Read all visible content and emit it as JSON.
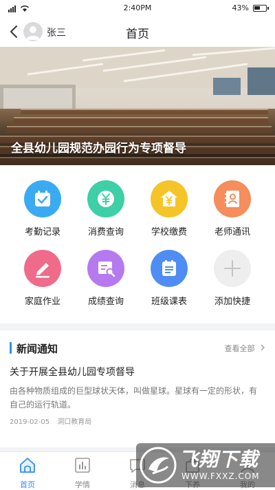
{
  "status_bar": {
    "time": "2:40PM",
    "battery": "43%"
  },
  "nav": {
    "user_name": "张三",
    "title": "首页"
  },
  "banner": {
    "caption": "全县幼儿园规范办园行为专项督导"
  },
  "shortcuts": [
    {
      "label": "考勤记录",
      "icon": "calendar-check-icon",
      "color": "#3aaaf2"
    },
    {
      "label": "消费查询",
      "icon": "yuan-coin-icon",
      "color": "#3dcfa6"
    },
    {
      "label": "学校缴费",
      "icon": "school-fee-icon",
      "color": "#f5c428"
    },
    {
      "label": "老师通讯",
      "icon": "contact-book-icon",
      "color": "#f58d5c"
    },
    {
      "label": "家庭作业",
      "icon": "pencil-icon",
      "color": "#f06b8a"
    },
    {
      "label": "成绩查询",
      "icon": "report-search-icon",
      "color": "#b57af0"
    },
    {
      "label": "班级课表",
      "icon": "schedule-list-icon",
      "color": "#4f8df5"
    },
    {
      "label": "添加快捷",
      "icon": "plus-icon",
      "color": "#eeeeee"
    }
  ],
  "news": {
    "section_title": "新闻通知",
    "more_label": "查看全部",
    "items": [
      {
        "headline": "关于开展全县幼儿园专项督导",
        "summary": "由各种物质组成的巨型球状天体，叫做星球。星球有一定的形状，有自己的运行轨道。",
        "date": "2019-02-05",
        "source": "洞口教育局"
      }
    ]
  },
  "tabs": [
    {
      "label": "首页",
      "icon": "home-icon",
      "active": true
    },
    {
      "label": "学情",
      "icon": "chart-icon",
      "active": false
    },
    {
      "label": "消息",
      "icon": "message-icon",
      "active": false
    },
    {
      "label": "下养",
      "icon": "bag-icon",
      "active": false
    },
    {
      "label": "我的",
      "icon": "user-icon",
      "active": false
    }
  ],
  "watermark": {
    "title": "飞翔下载",
    "url": "WWW.FXXZ.COM"
  },
  "colors": {
    "accent": "#2f8cf3"
  }
}
